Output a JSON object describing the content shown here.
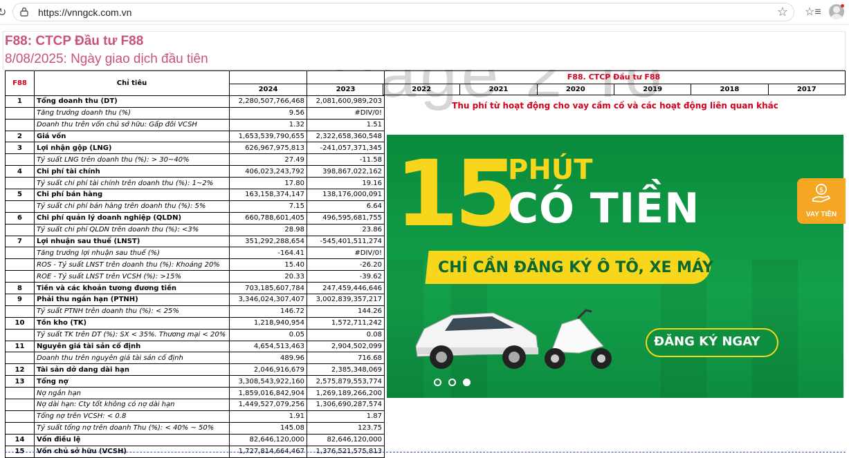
{
  "browser": {
    "url": "https://vnngck.com.vn",
    "icons": [
      "reload-icon",
      "lock-icon",
      "star-icon",
      "collections-icon",
      "profile-icon"
    ]
  },
  "header": {
    "title": "F88: CTCP Đầu tư F88",
    "subtitle": "8/08/2025: Ngày giao dịch đầu tiên"
  },
  "sheet": {
    "ticker": "F88",
    "indicator_header": "Chỉ tiêu",
    "company_header": "F88. CTCP Đầu tư F88",
    "years": [
      "2024",
      "2023",
      "2022",
      "2021",
      "2020",
      "2019",
      "2018",
      "2017"
    ],
    "rows": [
      {
        "no": "1",
        "label": "Tổng doanh thu (DT)",
        "v2024": "2,280,507,766,468",
        "v2023": "2,081,600,989,203",
        "style": "bold"
      },
      {
        "no": "",
        "label": "Tăng trưởng doanh thu (%)",
        "v2024": "9.56",
        "v2023": "#DIV/0!",
        "style": "ital"
      },
      {
        "no": "",
        "label": "Doanh thu trên vốn chủ sở hữu: Gấp đôi VCSH",
        "v2024": "1.32",
        "v2023": "1.51",
        "style": "ital"
      },
      {
        "no": "2",
        "label": "Giá vốn",
        "v2024": "1,653,539,790,655",
        "v2023": "2,322,658,360,548",
        "style": "bold"
      },
      {
        "no": "3",
        "label": "Lợi nhận gộp (LNG)",
        "v2024": "626,967,975,813",
        "v2023": "-241,057,371,345",
        "style": "bold"
      },
      {
        "no": "",
        "label": "Tỷ suất LNG trên doanh thu (%): > 30~40%",
        "v2024": "27.49",
        "v2023": "-11.58",
        "style": "ital"
      },
      {
        "no": "4",
        "label": "Chi phí tài chính",
        "v2024": "406,023,243,792",
        "v2023": "398,867,022,162",
        "style": "bold"
      },
      {
        "no": "",
        "label": "Tỷ suất chi phí tài chính trên doanh thu (%): 1~2%",
        "v2024": "17.80",
        "v2023": "19.16",
        "style": "ital"
      },
      {
        "no": "5",
        "label": "Chi phí bán hàng",
        "v2024": "163,158,374,147",
        "v2023": "138,176,000,091",
        "style": "bold"
      },
      {
        "no": "",
        "label": "Tỷ suất chi phí bán hàng trên doanh thu (%): 5%",
        "v2024": "7.15",
        "v2023": "6.64",
        "style": "ital"
      },
      {
        "no": "6",
        "label": "Chi phí quản lý doanh nghiệp (QLDN)",
        "v2024": "660,788,601,405",
        "v2023": "496,595,681,755",
        "style": "bold"
      },
      {
        "no": "",
        "label": "Tỷ suất chi phí QLDN trên doanh thu (%): <3%",
        "v2024": "28.98",
        "v2023": "23.86",
        "style": "ital"
      },
      {
        "no": "7",
        "label": "Lợi nhuận sau thuế (LNST)",
        "v2024": "351,292,288,654",
        "v2023": "-545,401,511,274",
        "style": "bold"
      },
      {
        "no": "",
        "label": "Tăng trưởng lợi nhuận sau thuế (%)",
        "v2024": "-164.41",
        "v2023": "#DIV/0!",
        "style": "ital"
      },
      {
        "no": "",
        "label": "ROS - Tỷ suất LNST trên doanh thu (%): Khoảng 20%",
        "v2024": "15.40",
        "v2023": "-26.20",
        "style": "ital"
      },
      {
        "no": "",
        "label": "ROE - Tỷ suất LNST trên VCSH (%): >15%",
        "v2024": "20.33",
        "v2023": "-39.62",
        "style": "ital"
      },
      {
        "no": "8",
        "label": "Tiền và các khoản tương đương tiền",
        "v2024": "703,185,607,784",
        "v2023": "247,459,446,646",
        "style": "bold"
      },
      {
        "no": "9",
        "label": "Phải thu ngắn hạn (PTNH)",
        "v2024": "3,346,024,307,407",
        "v2023": "3,002,839,357,217",
        "style": "bold"
      },
      {
        "no": "",
        "label": "Tỷ suất PTNH trên doanh thu (%): < 25%",
        "v2024": "146.72",
        "v2023": "144.26",
        "style": "ital"
      },
      {
        "no": "10",
        "label": "Tồn kho (TK)",
        "v2024": "1,218,940,954",
        "v2023": "1,572,711,242",
        "style": "bold"
      },
      {
        "no": "",
        "label": "Tỷ suất TK trên DT (%): SX < 35%. Thương mại < 20%",
        "v2024": "0.05",
        "v2023": "0.08",
        "style": "ital"
      },
      {
        "no": "11",
        "label": "Nguyên giá tài sản cố định",
        "v2024": "4,654,513,463",
        "v2023": "2,904,502,099",
        "style": "bold"
      },
      {
        "no": "",
        "label": "Doanh thu trên nguyên giá tài sản cố định",
        "v2024": "489.96",
        "v2023": "716.68",
        "style": "ital"
      },
      {
        "no": "12",
        "label": "Tài sản dở dang dài hạn",
        "v2024": "2,046,916,679",
        "v2023": "2,385,348,069",
        "style": "bold"
      },
      {
        "no": "13",
        "label": "Tổng nợ",
        "v2024": "3,308,543,922,160",
        "v2023": "2,575,879,553,774",
        "style": "bold"
      },
      {
        "no": "",
        "label": "Nợ ngắn hạn",
        "v2024": "1,859,016,842,904",
        "v2023": "1,269,189,266,200",
        "style": "ital"
      },
      {
        "no": "",
        "label": "Nợ dài hạn: Cty tốt không có nợ dài hạn",
        "v2024": "1,449,527,079,256",
        "v2023": "1,306,690,287,574",
        "style": "ital"
      },
      {
        "no": "",
        "label": "Tổng nợ trên VCSH: < 0.8",
        "v2024": "1.91",
        "v2023": "1.87",
        "style": "ital"
      },
      {
        "no": "",
        "label": "Tỷ suất tổng nợ trên doanh Thu (%): < 40% ~ 50%",
        "v2024": "145.08",
        "v2023": "123.75",
        "style": "ital"
      },
      {
        "no": "14",
        "label": "Vốn điều lệ",
        "v2024": "82,646,120,000",
        "v2023": "82,646,120,000",
        "style": "bold"
      },
      {
        "no": "15",
        "label": "Vốn chủ sở hữu (VCSH)",
        "v2024": "1,727,814,664,467",
        "v2023": "1,376,521,575,813",
        "style": "bold"
      }
    ]
  },
  "fee_note": "Thu phí từ hoạt động cho vay cầm cố và các hoạt động liên quan khác",
  "banner": {
    "number": "15",
    "phut": "PHÚT",
    "co_tien": "CÓ TIỀN",
    "pill_text": "CHỈ CẦN ĐĂNG KÝ Ô TÔ, XE MÁY",
    "cta": "ĐĂNG KÝ NGAY",
    "slide_count": 3,
    "active_slide": 3,
    "colors": {
      "green": "#0e8e3f",
      "yellow": "#f7d61c"
    }
  },
  "side_button": {
    "label": "VAY TIỀN",
    "icon": "money-hand-icon",
    "color": "#f5a623"
  }
}
